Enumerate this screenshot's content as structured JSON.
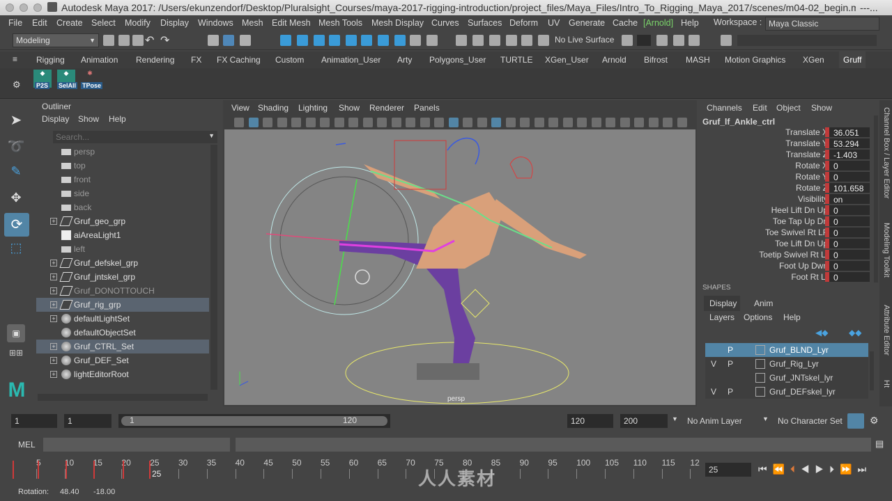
{
  "window": {
    "title": "Autodesk Maya 2017: /Users/ekunzendorf/Desktop/Pluralsight_Courses/maya-2017-rigging-introduction/project_files/Maya_Files/Intro_To_Rigging_Maya_2017/scenes/m04-02_begin.ma*",
    "title_suffix": "---..."
  },
  "menubar": [
    "File",
    "Edit",
    "Create",
    "Select",
    "Modify",
    "Display",
    "Windows",
    "Mesh",
    "Edit Mesh",
    "Mesh Tools",
    "Mesh Display",
    "Curves",
    "Surfaces",
    "Deform",
    "UV",
    "Generate",
    "Cache",
    "[Arnold]",
    "Help"
  ],
  "workspace": {
    "label": "Workspace :",
    "value": "Maya Classic"
  },
  "statusline": {
    "menuset": "Modeling",
    "live_surface": "No Live Surface"
  },
  "shelf_tabs": [
    "Rigging",
    "Animation",
    "Rendering",
    "FX",
    "FX Caching",
    "Custom",
    "Animation_User",
    "Arty",
    "Polygons_User",
    "TURTLE",
    "XGen_User",
    "Arnold",
    "Bifrost",
    "MASH",
    "Motion Graphics",
    "XGen",
    "Gruff"
  ],
  "shelf_buttons": [
    "P2S",
    "SelAll",
    "TPose"
  ],
  "outliner": {
    "title": "Outliner",
    "menu": [
      "Display",
      "Show",
      "Help"
    ],
    "search_placeholder": "Search...",
    "items": [
      {
        "label": "persp",
        "icon": "camera-icon",
        "expand": false,
        "dim": true,
        "hl": false
      },
      {
        "label": "top",
        "icon": "camera-icon",
        "expand": false,
        "dim": true,
        "hl": false
      },
      {
        "label": "front",
        "icon": "camera-icon",
        "expand": false,
        "dim": true,
        "hl": false
      },
      {
        "label": "side",
        "icon": "camera-icon",
        "expand": false,
        "dim": true,
        "hl": false
      },
      {
        "label": "back",
        "icon": "camera-icon",
        "expand": false,
        "dim": true,
        "hl": false
      },
      {
        "label": "Gruf_geo_grp",
        "icon": "group-icon",
        "expand": true,
        "dim": false,
        "hl": false
      },
      {
        "label": "aiAreaLight1",
        "icon": "light-icon",
        "expand": false,
        "dim": false,
        "hl": false
      },
      {
        "label": "left",
        "icon": "camera-icon",
        "expand": false,
        "dim": true,
        "hl": false
      },
      {
        "label": "Gruf_defskel_grp",
        "icon": "group-icon",
        "expand": true,
        "dim": false,
        "hl": false
      },
      {
        "label": "Gruf_jntskel_grp",
        "icon": "group-icon",
        "expand": true,
        "dim": false,
        "hl": false
      },
      {
        "label": "Gruf_DONOTTOUCH",
        "icon": "group-icon",
        "expand": true,
        "dim": true,
        "hl": false
      },
      {
        "label": "Gruf_rig_grp",
        "icon": "group-icon",
        "expand": true,
        "dim": false,
        "hl": true
      },
      {
        "label": "defaultLightSet",
        "icon": "set-icon",
        "expand": true,
        "dim": false,
        "hl": false
      },
      {
        "label": "defaultObjectSet",
        "icon": "set-icon",
        "expand": false,
        "dim": false,
        "hl": false
      },
      {
        "label": "Gruf_CTRL_Set",
        "icon": "set-icon",
        "expand": true,
        "dim": false,
        "hl": true
      },
      {
        "label": "Gruf_DEF_Set",
        "icon": "set-icon",
        "expand": true,
        "dim": false,
        "hl": false
      },
      {
        "label": "lightEditorRoot",
        "icon": "set-icon",
        "expand": true,
        "dim": false,
        "hl": false
      }
    ]
  },
  "viewport": {
    "menu": [
      "View",
      "Shading",
      "Lighting",
      "Show",
      "Renderer",
      "Panels"
    ],
    "camera_label": "persp"
  },
  "channelbox": {
    "menu": [
      "Channels",
      "Edit",
      "Object",
      "Show"
    ],
    "node": "Gruf_lf_Ankle_ctrl",
    "channels": [
      {
        "name": "Translate X",
        "value": "36.051"
      },
      {
        "name": "Translate Y",
        "value": "53.294"
      },
      {
        "name": "Translate Z",
        "value": "-1.403"
      },
      {
        "name": "Rotate X",
        "value": "0"
      },
      {
        "name": "Rotate Y",
        "value": "0"
      },
      {
        "name": "Rotate Z",
        "value": "101.658"
      },
      {
        "name": "Visibility",
        "value": "on"
      },
      {
        "name": "Heel Lift Dn Up",
        "value": "0"
      },
      {
        "name": "Toe Tap Up Dn",
        "value": "0"
      },
      {
        "name": "Toe Swivel Rt LF",
        "value": "0"
      },
      {
        "name": "Toe Lift Dn Up",
        "value": "0"
      },
      {
        "name": "Toetip Swivel Rt Lf",
        "value": "0"
      },
      {
        "name": "Foot Up Dwn",
        "value": "0"
      },
      {
        "name": "Foot Rt Lf",
        "value": "0"
      }
    ],
    "shapes_label": "SHAPES"
  },
  "layer_editor": {
    "tabs": [
      "Display",
      "Anim"
    ],
    "menu": [
      "Layers",
      "Options",
      "Help"
    ],
    "layers": [
      {
        "v": "",
        "p": "P",
        "name": "Gruf_BLND_Lyr",
        "hl": true
      },
      {
        "v": "V",
        "p": "P",
        "name": "Gruf_Rig_Lyr",
        "hl": false
      },
      {
        "v": "",
        "p": "",
        "name": "Gruf_JNTskel_lyr",
        "hl": false
      },
      {
        "v": "V",
        "p": "P",
        "name": "Gruf_DEFskel_lyr",
        "hl": false
      }
    ]
  },
  "side_tabs": [
    "Channel Box / Layer Editor",
    "Modeling Toolkit",
    "Attribute Editor",
    "Ht"
  ],
  "range": {
    "start": "1",
    "playback_start": "1",
    "slider_start": "1",
    "slider_end": "120",
    "playback_end": "120",
    "end": "200",
    "anim_layer": "No Anim Layer",
    "character_set": "No Character Set"
  },
  "mel": {
    "label": "MEL"
  },
  "timeline": {
    "ticks": [
      "5",
      "10",
      "15",
      "20",
      "25",
      "30",
      "35",
      "40",
      "45",
      "50",
      "55",
      "60",
      "65",
      "70",
      "75",
      "80",
      "85",
      "90",
      "95",
      "100",
      "105",
      "110",
      "115",
      "12"
    ],
    "current_marker": "25",
    "current_frame": "25"
  },
  "helpline": {
    "label": "Rotation:",
    "v1": "48.40",
    "v2": "-18.00"
  },
  "watermark": "人人素材"
}
